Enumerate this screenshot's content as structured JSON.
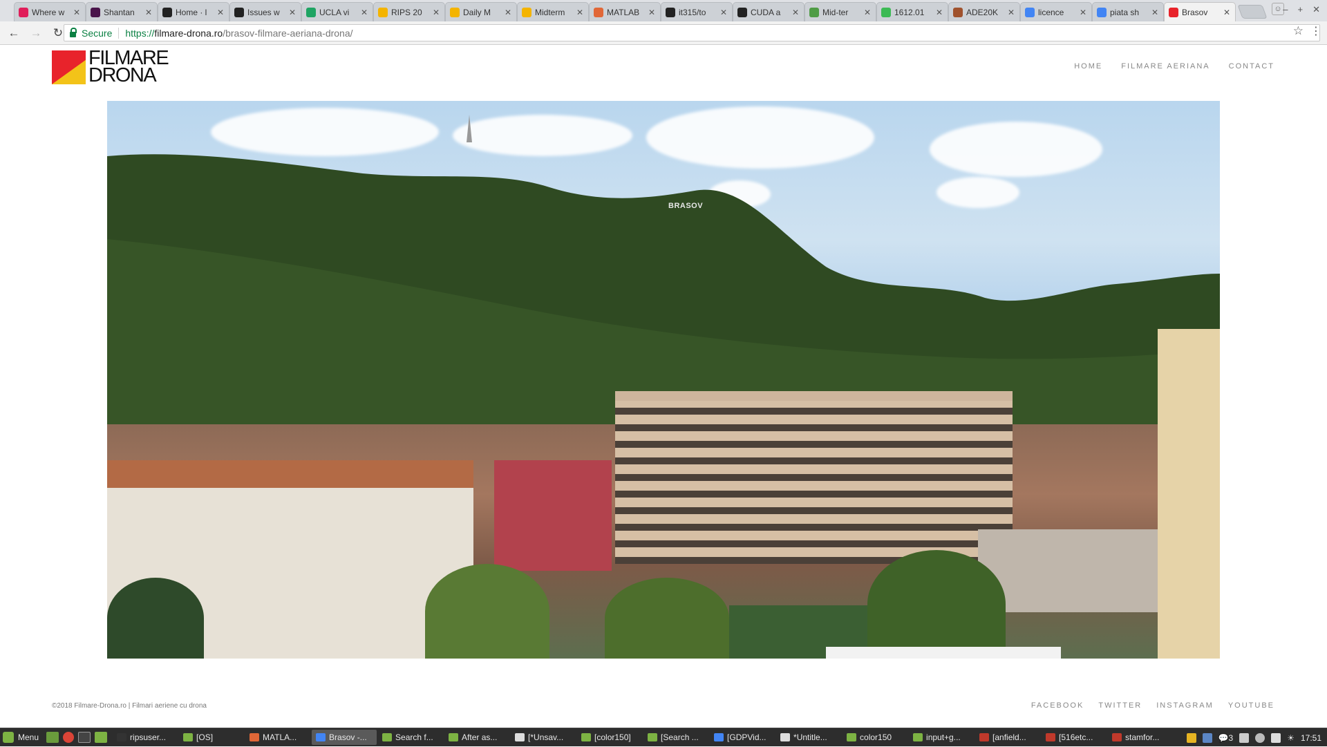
{
  "browser": {
    "tabs": [
      {
        "title": "Where w",
        "icon": "slack-icon",
        "color": "#e01e5a"
      },
      {
        "title": "Shantan",
        "icon": "slack-icon",
        "color": "#4a154b"
      },
      {
        "title": "Home · l",
        "icon": "github-icon",
        "color": "#222222"
      },
      {
        "title": "Issues w",
        "icon": "github-icon",
        "color": "#222222"
      },
      {
        "title": "UCLA vi",
        "icon": "drive-icon",
        "color": "#1fa463"
      },
      {
        "title": "RIPS 20",
        "icon": "slides-icon",
        "color": "#f4b400"
      },
      {
        "title": "Daily M",
        "icon": "slides-icon",
        "color": "#f4b400"
      },
      {
        "title": "Midterm",
        "icon": "slides-icon",
        "color": "#f4b400"
      },
      {
        "title": "MATLAB",
        "icon": "matlab-icon",
        "color": "#e16737"
      },
      {
        "title": "it315/to",
        "icon": "github-icon",
        "color": "#222222"
      },
      {
        "title": "CUDA a",
        "icon": "github-icon",
        "color": "#222222"
      },
      {
        "title": "Mid-ter",
        "icon": "overleaf-icon",
        "color": "#4f9c45"
      },
      {
        "title": "1612.01",
        "icon": "arxiv-icon",
        "color": "#3cba54"
      },
      {
        "title": "ADE20K",
        "icon": "document-icon",
        "color": "#a0522d"
      },
      {
        "title": "licence",
        "icon": "google-icon",
        "color": "#4285f4"
      },
      {
        "title": "piata sh",
        "icon": "google-icon",
        "color": "#4285f4"
      },
      {
        "title": "Brasov",
        "icon": "filmare-drona-icon",
        "color": "#e8232b",
        "active": true
      }
    ],
    "address": {
      "secure_label": "Secure",
      "url_protocol": "https://",
      "url_host": "filmare-drona.ro",
      "url_path": "/brasov-filmare-aeriana-drona/"
    }
  },
  "site": {
    "logo_line1": "FILMARE",
    "logo_line2": "DRONA",
    "nav": [
      "HOME",
      "FILMARE AERIANA",
      "CONTACT"
    ],
    "hero_sign_text": "BRASOV",
    "footer_text": "©2018 Filmare-Drona.ro | Filmari aeriene cu drona",
    "social": [
      "FACEBOOK",
      "TWITTER",
      "INSTAGRAM",
      "YOUTUBE"
    ],
    "colors": {
      "logo_red": "#e8232b",
      "logo_yellow": "#f3c319"
    }
  },
  "taskbar": {
    "menu_label": "Menu",
    "items": [
      {
        "label": "ripsuser...",
        "icon": "terminal-icon"
      },
      {
        "label": "[OS]",
        "icon": "folder-icon"
      },
      {
        "label": "MATLA...",
        "icon": "matlab-icon"
      },
      {
        "label": "Brasov -...",
        "icon": "chrome-icon",
        "active": true
      },
      {
        "label": "Search f...",
        "icon": "folder-icon"
      },
      {
        "label": "After as...",
        "icon": "folder-icon"
      },
      {
        "label": "[*Unsav...",
        "icon": "text-editor-icon"
      },
      {
        "label": "[color150]",
        "icon": "folder-icon"
      },
      {
        "label": "[Search ...",
        "icon": "folder-icon"
      },
      {
        "label": "[GDPVid...",
        "icon": "chrome-icon"
      },
      {
        "label": "*Untitle...",
        "icon": "text-editor-icon"
      },
      {
        "label": "color150",
        "icon": "folder-icon"
      },
      {
        "label": "input+g...",
        "icon": "folder-icon"
      },
      {
        "label": "[anfield...",
        "icon": "image-viewer-icon"
      },
      {
        "label": "[516etc...",
        "icon": "image-viewer-icon"
      },
      {
        "label": "stamfor...",
        "icon": "image-viewer-icon"
      }
    ],
    "tray_count": "3",
    "clock": "17:51"
  }
}
